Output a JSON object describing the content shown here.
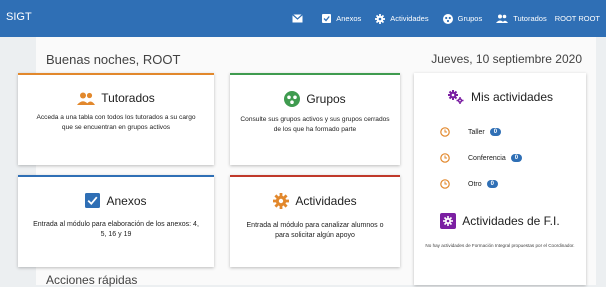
{
  "navbar": {
    "brand": "SIGT",
    "items": [
      {
        "label": "",
        "icon": "mail-icon"
      },
      {
        "label": "Anexos",
        "icon": "checkbox-icon"
      },
      {
        "label": "Actividades",
        "icon": "gear-icon"
      },
      {
        "label": "Grupos",
        "icon": "groups-icon"
      },
      {
        "label": "Tutorados",
        "icon": "people-icon"
      }
    ],
    "user": "ROOT ROOT"
  },
  "greeting": "Buenas noches, ROOT",
  "date": "Jueves, 10 septiembre 2020",
  "cards": {
    "tutorados": {
      "title": "Tutorados",
      "description": "Acceda a una tabla con todos los tutorados a su cargo que se encuentran en grupos activos",
      "accent": "#e2882c"
    },
    "grupos": {
      "title": "Grupos",
      "description": "Consulte sus grupos activos y sus grupos cerrados de los que ha formado parte",
      "accent": "#3f9b4f"
    },
    "anexos": {
      "title": "Anexos",
      "description": "Entrada al módulo para elaboración de los anexos: 4, 5, 16 y 19",
      "accent": "#2f6fb5"
    },
    "actividades": {
      "title": "Actividades",
      "description": "Entrada al módulo para canalizar alumnos o para solicitar algún apoyo",
      "accent": "#c0392b"
    }
  },
  "mis_actividades": {
    "title": "Mis actividades",
    "items": [
      {
        "label": "Taller",
        "count": "0"
      },
      {
        "label": "Conferencia",
        "count": "0"
      },
      {
        "label": "Otro",
        "count": "0"
      }
    ]
  },
  "actividades_fi": {
    "title": "Actividades de F.I.",
    "note": "No hay actividades de Formación Integral propuestas por el Coordinador."
  },
  "acciones_rapidas": "Acciones rápidas",
  "colors": {
    "primary": "#2f6fb5",
    "purple": "#7b1fa2",
    "orange": "#e2882c"
  }
}
